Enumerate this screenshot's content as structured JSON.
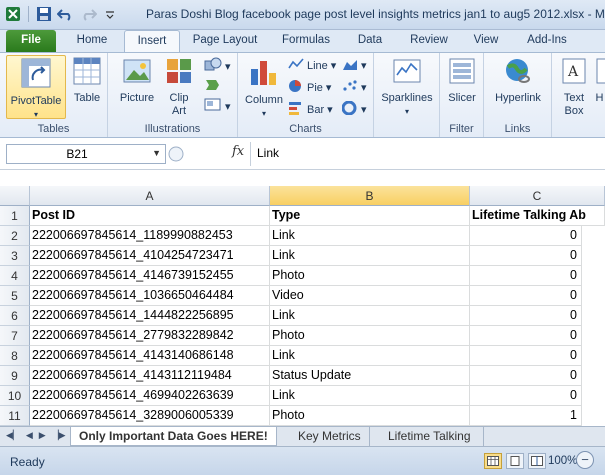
{
  "window": {
    "title": "Paras Doshi Blog facebook page post level insights metrics jan1 to aug5 2012.xlsx - Mic"
  },
  "tabs": [
    {
      "label": "File"
    },
    {
      "label": "Home"
    },
    {
      "label": "Insert"
    },
    {
      "label": "Page Layout"
    },
    {
      "label": "Formulas"
    },
    {
      "label": "Data"
    },
    {
      "label": "Review"
    },
    {
      "label": "View"
    },
    {
      "label": "Add-Ins"
    }
  ],
  "ribbon": {
    "pivottable": "PivotTable",
    "table": "Table",
    "picture": "Picture",
    "clipart_1": "Clip",
    "clipart_2": "Art",
    "column": "Column",
    "line": "Line",
    "pie": "Pie",
    "bar": "Bar",
    "sparklines": "Sparklines",
    "slicer": "Slicer",
    "hyperlink": "Hyperlink",
    "textbox_1": "Text",
    "textbox_2": "Box",
    "more": "H",
    "groups": {
      "tables": "Tables",
      "illustrations": "Illustrations",
      "charts": "Charts",
      "filter": "Filter",
      "links": "Links"
    }
  },
  "formula_bar": {
    "name_box": "B21",
    "fx": "fx",
    "formula": "Link"
  },
  "columns": [
    "A",
    "B",
    "C"
  ],
  "headers": {
    "post_id": "Post ID",
    "type": "Type",
    "lifetime": "Lifetime Talking Ab"
  },
  "rows": [
    {
      "num": "1"
    },
    {
      "num": "2",
      "post_id": "222006697845614_1189990882453",
      "type": "Link",
      "value": "0"
    },
    {
      "num": "3",
      "post_id": "222006697845614_4104254723471",
      "type": "Link",
      "value": "0"
    },
    {
      "num": "4",
      "post_id": "222006697845614_4146739152455",
      "type": "Photo",
      "value": "0"
    },
    {
      "num": "5",
      "post_id": "222006697845614_1036650464484",
      "type": "Video",
      "value": "0"
    },
    {
      "num": "6",
      "post_id": "222006697845614_1444822256895",
      "type": "Link",
      "value": "0"
    },
    {
      "num": "7",
      "post_id": "222006697845614_2779832289842",
      "type": "Photo",
      "value": "0"
    },
    {
      "num": "8",
      "post_id": "222006697845614_4143140686148",
      "type": "Link",
      "value": "0"
    },
    {
      "num": "9",
      "post_id": "222006697845614_4143112119484",
      "type": "Status Update",
      "value": "0"
    },
    {
      "num": "10",
      "post_id": "222006697845614_4699402263639",
      "type": "Link",
      "value": "0"
    },
    {
      "num": "11",
      "post_id": "222006697845614_3289006005339",
      "type": "Photo",
      "value": "1"
    }
  ],
  "sheets": {
    "active": "Only Important Data Goes HERE!",
    "s2": "Key Metrics",
    "s3": "Lifetime Talking"
  },
  "status": {
    "ready": "Ready",
    "zoom": "100%",
    "minus": "−"
  },
  "colors": {
    "file_tab": "#2a7a1c",
    "selection_header": "#f8cf63"
  }
}
